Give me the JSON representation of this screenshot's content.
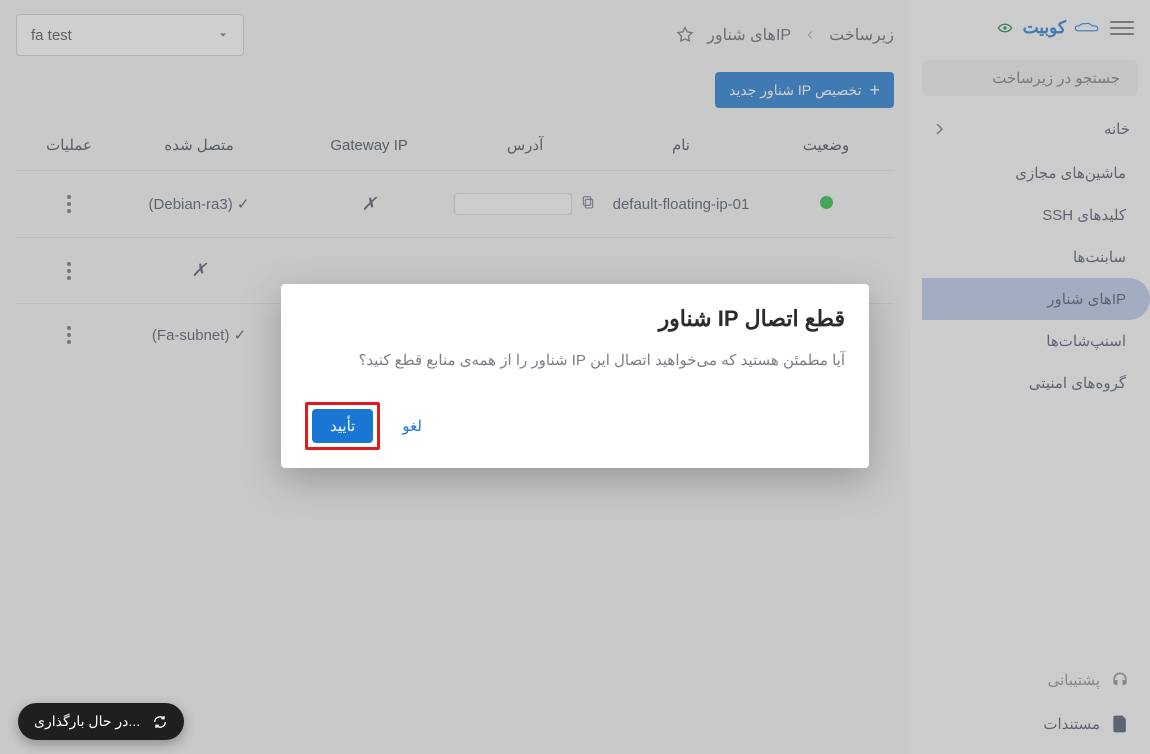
{
  "brand": {
    "name": "کوبیت"
  },
  "search": {
    "placeholder": "جستجو در زیرساخت"
  },
  "home_label": "خانه",
  "nav": [
    {
      "label": "ماشین‌های مجازی"
    },
    {
      "label": "کلیدهای SSH"
    },
    {
      "label": "سابنت‌ها"
    },
    {
      "label": "IPهای شناور",
      "active": true
    },
    {
      "label": "اسنپ‌شات‌ها"
    },
    {
      "label": "گروه‌های امنیتی"
    }
  ],
  "support_label": "پشتیبانی",
  "docs_label": "مستندات",
  "breadcrumb": {
    "root": "زیرساخت",
    "page": "IPهای شناور"
  },
  "project": {
    "selected": "fa test"
  },
  "allocate_btn": "تخصیص IP شناور جدید",
  "columns": {
    "status": "وضعیت",
    "name": "نام",
    "address": "آدرس",
    "gateway": "Gateway IP",
    "connected": "متصل شده",
    "actions": "عملیات"
  },
  "rows": [
    {
      "status": "up",
      "name": "default-floating-ip-01",
      "address": "",
      "gateway": "x",
      "connected": "(Debian-ra3)",
      "connected_check": true
    },
    {
      "status": "",
      "name": "",
      "address": "",
      "gateway": "",
      "connected": "",
      "connected_x": true
    },
    {
      "status": "",
      "name": "",
      "address": "",
      "gateway": "",
      "connected": "(Fa-subnet)",
      "connected_check": true
    }
  ],
  "dialog": {
    "title": "قطع اتصال IP شناور",
    "body": "آیا مطمئن هستید که می‌خواهید اتصال این IP شناور را از همه‌ی منابع قطع کنید؟",
    "confirm": "تأیید",
    "cancel": "لغو"
  },
  "loading": "...در حال بارگذاری"
}
